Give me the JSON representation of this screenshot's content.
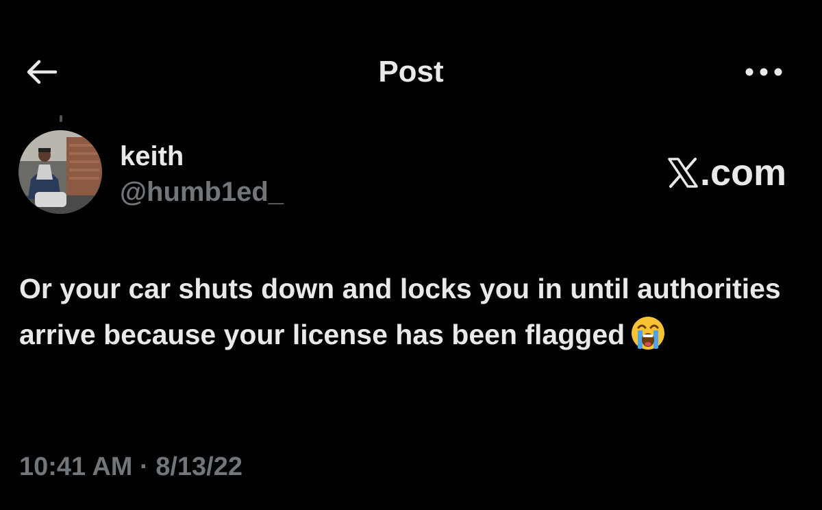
{
  "header": {
    "back_icon": "arrow-left-icon",
    "title": "Post",
    "more_icon": "ellipsis-horizontal-icon"
  },
  "post": {
    "author": {
      "display_name": "keith",
      "handle": "@humb1ed_",
      "avatar": "user-avatar-photo"
    },
    "watermark": {
      "logo": "X",
      "suffix": ".com"
    },
    "text": "Or your car shuts down and locks you in until authorities arrive because your license has been flagged",
    "emoji": "loudly-crying-face",
    "timestamp": "10:41 AM · 8/13/22"
  },
  "colors": {
    "background": "#000000",
    "primary_text": "#e7e9ea",
    "secondary_text": "#71767b"
  }
}
